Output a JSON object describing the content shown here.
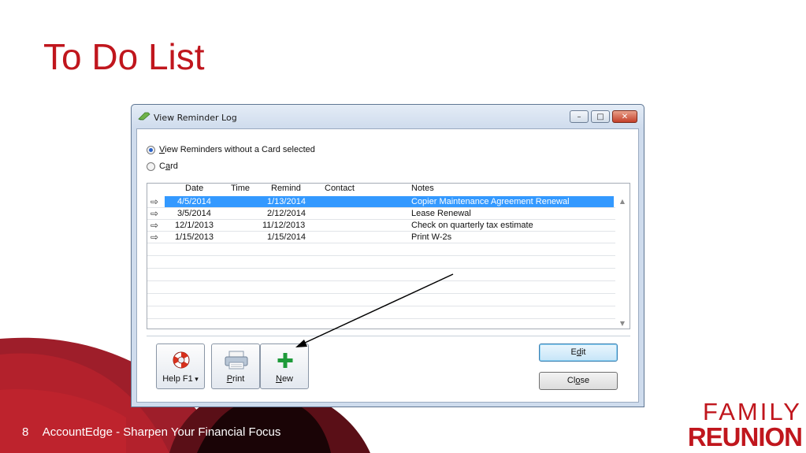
{
  "slide": {
    "title": "To Do List",
    "page_number": "8",
    "footer_text": "AccountEdge - Sharpen Your Financial Focus",
    "logo_line1": "FAMILY",
    "logo_line2": "REUNION"
  },
  "window": {
    "title": "View Reminder Log",
    "controls": {
      "minimize": "–",
      "maximize": "□",
      "close": "✕"
    }
  },
  "filters": {
    "option1": {
      "accel": "V",
      "rest": "iew Reminders without a Card selected",
      "selected": true
    },
    "option2": {
      "pre": "C",
      "accel": "a",
      "rest": "rd",
      "selected": false
    }
  },
  "table": {
    "headers": {
      "date": "Date",
      "time": "Time",
      "remind": "Remind",
      "contact": "Contact",
      "notes": "Notes"
    },
    "rows": [
      {
        "date": "4/5/2014",
        "time": "",
        "remind": "1/13/2014",
        "contact": "",
        "notes": "Copier Maintenance Agreement Renewal",
        "selected": true
      },
      {
        "date": "3/5/2014",
        "time": "",
        "remind": "2/12/2014",
        "contact": "",
        "notes": "Lease Renewal",
        "selected": false
      },
      {
        "date": "12/1/2013",
        "time": "",
        "remind": "11/12/2013",
        "contact": "",
        "notes": "Check on quarterly tax estimate",
        "selected": false
      },
      {
        "date": "1/15/2013",
        "time": "",
        "remind": "1/15/2014",
        "contact": "",
        "notes": "Print W-2s",
        "selected": false
      }
    ]
  },
  "toolbar": {
    "help": "Help F1",
    "print_accel": "P",
    "print_rest": "rint",
    "new_accel": "N",
    "new_rest": "ew"
  },
  "buttons": {
    "edit_pre": "E",
    "edit_accel": "d",
    "edit_rest": "it",
    "close_pre": "Cl",
    "close_accel": "o",
    "close_rest": "se"
  },
  "colors": {
    "brand_red": "#c0161d",
    "selection_blue": "#3399ff",
    "new_icon_green": "#1e9a3a"
  },
  "icons": {
    "help": "lifebuoy-icon",
    "print": "printer-icon",
    "new": "plus-icon",
    "row_marker": "arrow-right-icon"
  }
}
